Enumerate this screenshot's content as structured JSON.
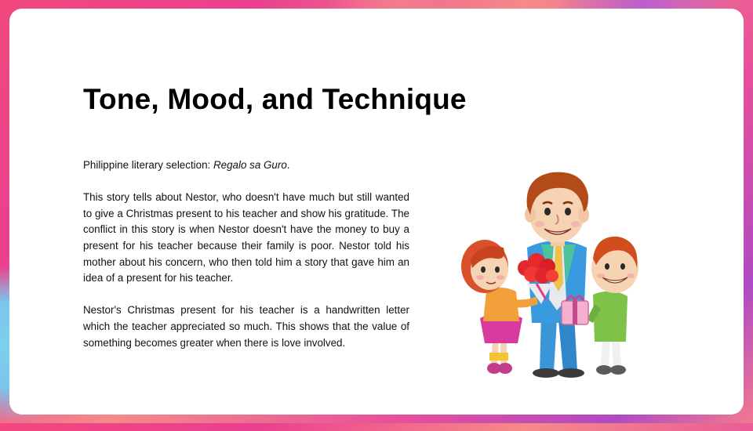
{
  "slide": {
    "title": "Tone, Mood, and Technique",
    "intro_label": "Philippine literary selection: ",
    "intro_title": "Regalo sa Guro",
    "intro_end": ".",
    "paragraph_1": "This story tells about Nestor, who doesn't have much but still wanted to give a Christmas present to his teacher and show his gratitude. The conflict in this story is when Nestor doesn't have the money to buy a present for his teacher because their family is poor. Nestor told his mother about his concern, who then told him a story that gave him an idea of a present for his teacher.",
    "paragraph_2": "Nestor's Christmas present for his teacher is a handwritten letter which the teacher appreciated so much. This shows that the value of something becomes greater when there is love involved."
  },
  "colors": {
    "frame_pink": "#ea3f8f",
    "frame_blue": "#78c6ee",
    "frame_purple": "#b04ac4"
  }
}
